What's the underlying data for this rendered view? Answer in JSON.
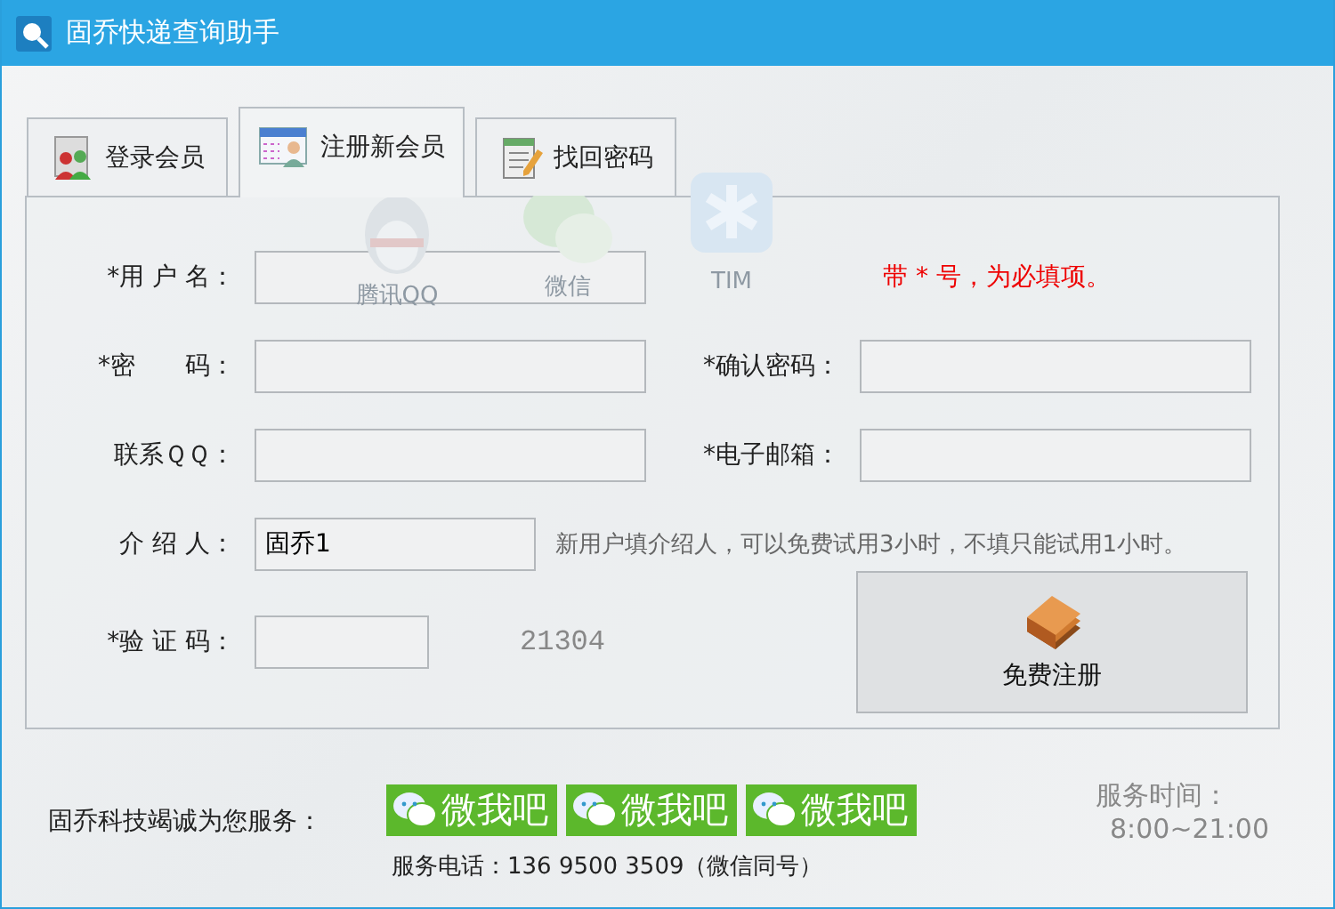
{
  "window": {
    "title": "固乔快递查询助手"
  },
  "tabs": [
    {
      "label": "登录会员",
      "selected": false
    },
    {
      "label": "注册新会员",
      "selected": true
    },
    {
      "label": "找回密码",
      "selected": false
    }
  ],
  "desktop_shortcuts": [
    {
      "label": "腾讯QQ"
    },
    {
      "label": "微信"
    },
    {
      "label": "TIM"
    }
  ],
  "form": {
    "required_note": "带 * 号，为必填项。",
    "username": {
      "label": "*用 户 名："
    },
    "password": {
      "label": "*密　　码："
    },
    "confirm_password": {
      "label": "*确认密码："
    },
    "qq": {
      "label": "联系ＱＱ："
    },
    "email": {
      "label": "*电子邮箱："
    },
    "referrer": {
      "label": "介 绍 人：",
      "value": "固乔1",
      "hint": "新用户填介绍人，可以免费试用3小时，不填只能试用1小时。"
    },
    "captcha": {
      "label": "*验 证 码：",
      "code": "21304"
    },
    "register_button": {
      "label": "免费注册"
    }
  },
  "footer": {
    "slogan": "固乔科技竭诚为您服务：",
    "wechat_buttons": [
      "微我吧",
      "微我吧",
      "微我吧"
    ],
    "phone": "服务电话：136 9500 3509（微信同号）",
    "hours_label": "服务时间：",
    "hours": "8:00~21:00"
  }
}
